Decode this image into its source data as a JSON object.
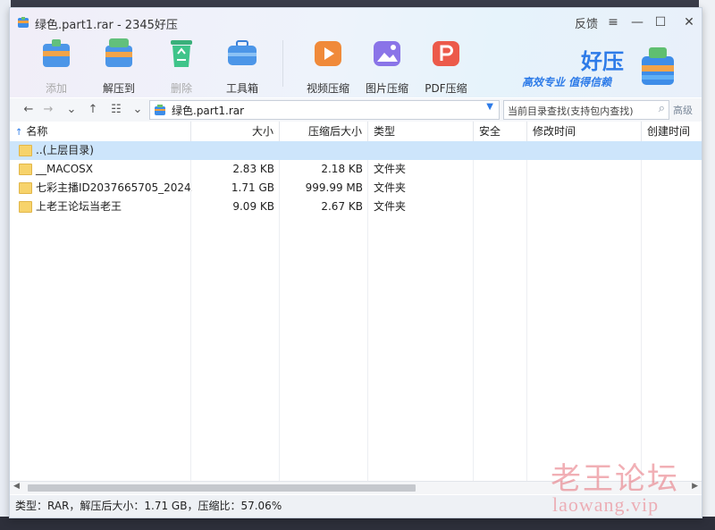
{
  "window": {
    "title": "绿色.part1.rar - 2345好压",
    "controls": {
      "feedback": "反馈",
      "menu": "≡",
      "minimize": "—",
      "maximize": "☐",
      "close": "✕"
    }
  },
  "toolbar": {
    "add": "添加",
    "extract": "解压到",
    "delete": "删除",
    "tools": "工具箱",
    "video_compress": "视频压缩",
    "image_compress": "图片压缩",
    "pdf_compress": "PDF压缩"
  },
  "brand": {
    "name": "好压",
    "slogan": "高效专业  值得信赖"
  },
  "nav": {
    "path": "绿色.part1.rar",
    "search_placeholder": "当前目录查找(支持包内查找)",
    "advanced": "高级"
  },
  "columns": [
    "名称",
    "大小",
    "压缩后大小",
    "类型",
    "安全",
    "修改时间",
    "创建时间"
  ],
  "sort_indicator": "↑",
  "rows": [
    {
      "name": "..(上层目录)",
      "size": "",
      "packed": "",
      "type": "",
      "selected": true
    },
    {
      "name": "__MACOSX",
      "size": "2.83 KB",
      "packed": "2.18 KB",
      "type": "文件夹",
      "selected": false
    },
    {
      "name": "七彩主播ID2037665705_2024...",
      "size": "1.71 GB",
      "packed": "999.99 MB",
      "type": "文件夹",
      "selected": false
    },
    {
      "name": "上老王论坛当老王",
      "size": "9.09 KB",
      "packed": "2.67 KB",
      "type": "文件夹",
      "selected": false
    }
  ],
  "status": "类型：RAR，解压后大小：1.71 GB，压缩比：57.06%",
  "watermark": {
    "text": "老王论坛",
    "url": "laowang.vip"
  },
  "colors": {
    "accent": "#2d7be8",
    "selection": "#cde5fb",
    "folder": "#f7d36b"
  }
}
